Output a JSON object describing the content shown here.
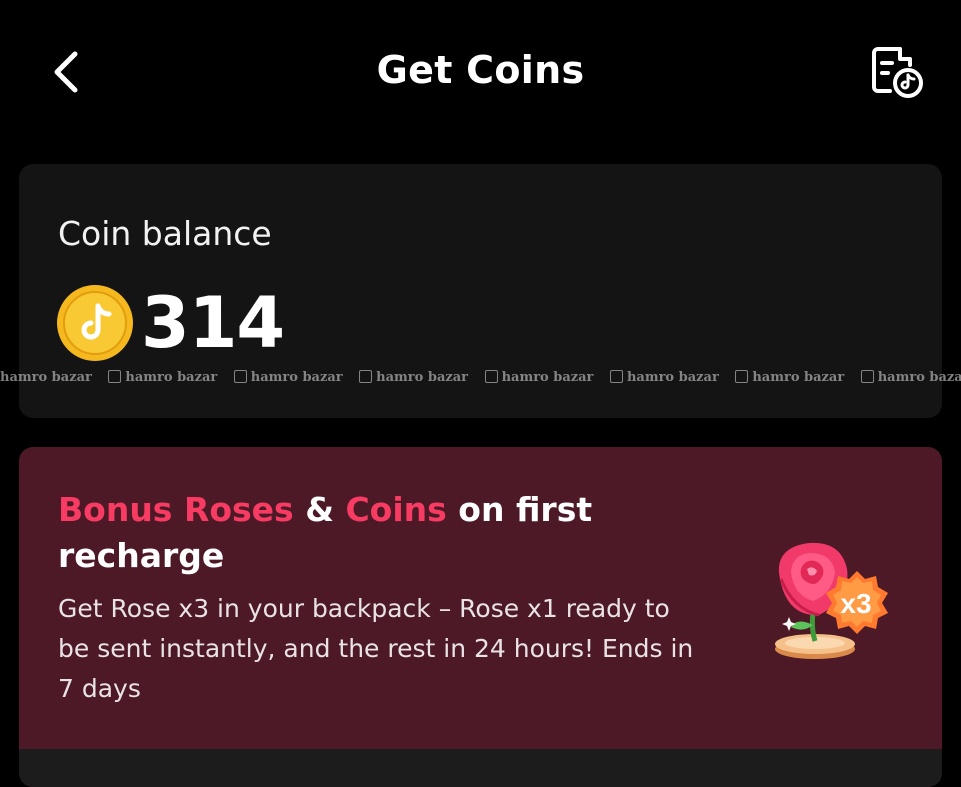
{
  "header": {
    "title": "Get Coins",
    "back_icon": "chevron-left-icon",
    "history_icon": "transaction-history-icon"
  },
  "balance": {
    "label": "Coin balance",
    "value": "314",
    "coin_icon": "tiktok-coin-icon"
  },
  "watermark": {
    "text": "hamro bazar"
  },
  "promo": {
    "title_part1": "Bonus Roses",
    "title_part2": " & ",
    "title_part3": "Coins",
    "title_part4": " on first recharge",
    "description": "Get Rose x3 in your backpack – Rose x1 ready to be sent instantly, and the rest in 24 hours! Ends in 7 days",
    "illustration": "rose-x3-icon",
    "badge_text": "x3"
  },
  "colors": {
    "background": "#000000",
    "card": "#141414",
    "promo_card": "#4d1927",
    "accent_pink": "#f83b62",
    "coin_gold": "#f5b81e"
  }
}
